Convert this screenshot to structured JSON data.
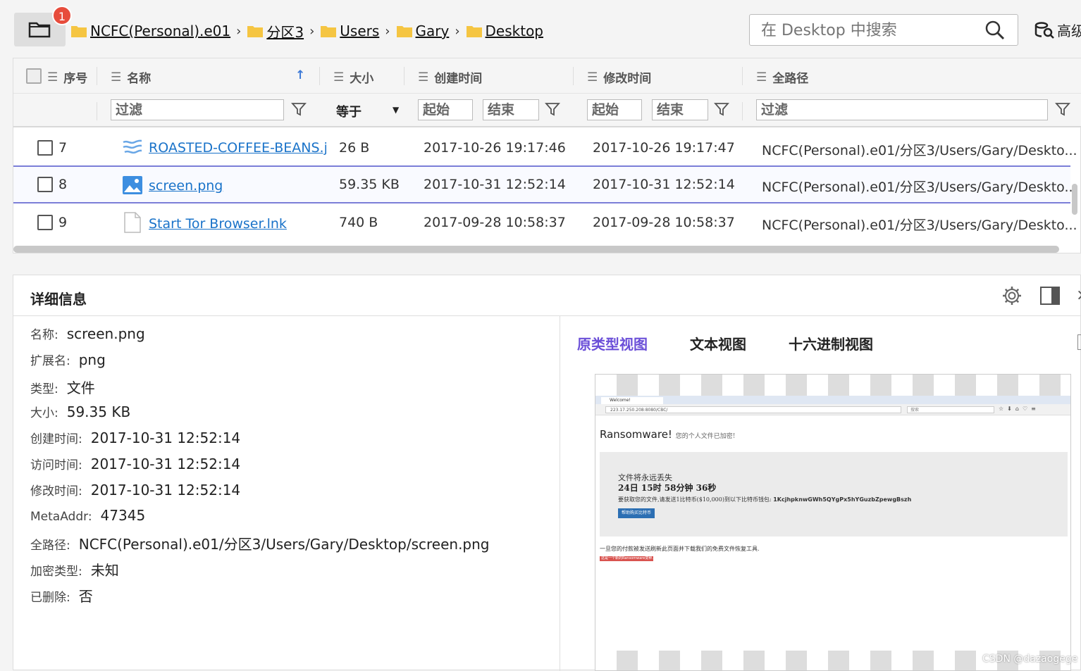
{
  "toolbar": {
    "badge": "1",
    "breadcrumbs": [
      "NCFC(Personal).e01",
      "分区3",
      "Users",
      "Gary",
      "Desktop"
    ],
    "search_placeholder": "在 Desktop 中搜索",
    "advanced_label": "高级"
  },
  "table": {
    "headers": {
      "index": "序号",
      "name": "名称",
      "size": "大小",
      "created": "创建时间",
      "modified": "修改时间",
      "path": "全路径"
    },
    "filters": {
      "name": "过滤",
      "size_op": "等于",
      "created_start": "起始",
      "created_end": "结束",
      "modified_start": "起始",
      "modified_end": "结束",
      "path": "过滤"
    },
    "rows": [
      {
        "index": "7",
        "name": "ROASTED-COFFEE-BEANS.j",
        "size": "26 B",
        "created": "2017-10-26 19:17:46",
        "modified": "2017-10-26 19:17:47",
        "path": "NCFC(Personal).e01/分区3/Users/Gary/Deskto...",
        "icon": "text-lines-icon"
      },
      {
        "index": "8",
        "name": "screen.png",
        "size": "59.35 KB",
        "created": "2017-10-31 12:52:14",
        "modified": "2017-10-31 12:52:14",
        "path": "NCFC(Personal).e01/分区3/Users/Gary/Deskto...",
        "icon": "image-file-icon"
      },
      {
        "index": "9",
        "name": "Start Tor Browser.lnk",
        "size": "740 B",
        "created": "2017-09-28 10:58:37",
        "modified": "2017-09-28 10:58:37",
        "path": "NCFC(Personal).e01/分区3/Users/Gary/Deskto...",
        "icon": "blank-file-icon"
      }
    ]
  },
  "details": {
    "title": "详细信息",
    "props": [
      {
        "k": "名称:",
        "v": "screen.png"
      },
      {
        "k": "扩展名:",
        "v": "png"
      },
      {
        "k": "类型:",
        "v": "文件"
      },
      {
        "k": "大小:",
        "v": "59.35 KB"
      },
      {
        "k": "创建时间:",
        "v": "2017-10-31 12:52:14"
      },
      {
        "k": "访问时间:",
        "v": "2017-10-31 12:52:14"
      },
      {
        "k": "修改时间:",
        "v": "2017-10-31 12:52:14"
      },
      {
        "k": "MetaAddr:",
        "v": "47345"
      },
      {
        "k": "全路径:",
        "v": "NCFC(Personal).e01/分区3/Users/Gary/Desktop/screen.png"
      },
      {
        "k": "加密类型:",
        "v": "未知"
      },
      {
        "k": "已删除:",
        "v": "否"
      }
    ],
    "tabs": [
      "原类型视图",
      "文本视图",
      "十六进制视图"
    ],
    "active_tab": 0
  },
  "preview": {
    "tab_title": "Welcome!",
    "url": "223.17.250.208:8080/CBC/",
    "search": "搜索",
    "title": "Ransomware!",
    "subtitle": "您的个人文件已加密!",
    "line1": "文件将永远丢失",
    "countdown": "24日 15时 58分钟 36秒",
    "line3": "要获取您的文件,请发送1比特币($10,000)到以下比特币钱包:",
    "wallet": "1KcjhpknwGWh5QYgPx5hYGuzbZpewgBszh",
    "button": "帮助购买比特币",
    "line4": "一旦您的付款被发送刷新此页面并下载我们的免费文件恢复工具.",
    "red_button": "这是一个新的Ransomware变种..."
  },
  "watermark": "CSDN @dazaogege",
  "colors": {
    "accent": "#6b4fd8",
    "link": "#1a73c9",
    "badge": "#e74c3c",
    "folder": "#f5c542"
  }
}
